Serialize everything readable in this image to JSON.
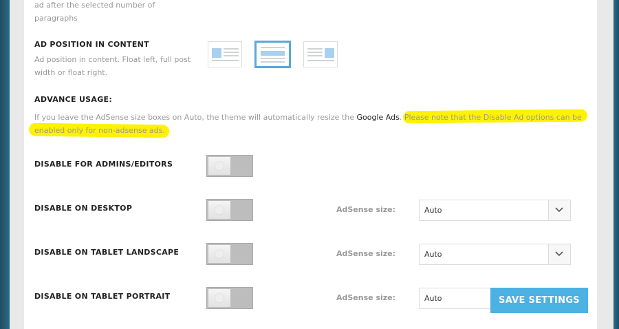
{
  "top_note": {
    "line1": "ad after the selected number of",
    "line2": "paragraphs"
  },
  "ad_position": {
    "title": "AD POSITION IN CONTENT",
    "desc_line1": "Ad position in content. Float left, full post",
    "desc_line2": "width or float right."
  },
  "advance": {
    "title": "ADVANCE USAGE:",
    "line1_before": "If you leave the AdSense size boxes on Auto, the theme will automatically resize the ",
    "line1_link": "Google Ads",
    "line1_after": ". Please note that the Disable Ad options can be",
    "line2": "enabled only for non-adsense ads."
  },
  "rows": [
    {
      "label": "DISABLE FOR ADMINS/EDITORS"
    },
    {
      "label": "DISABLE ON DESKTOP",
      "adsense_label": "AdSense size:",
      "select_value": "Auto"
    },
    {
      "label": "DISABLE ON TABLET LANDSCAPE",
      "adsense_label": "AdSense size:",
      "select_value": "Auto"
    },
    {
      "label": "DISABLE ON TABLET PORTRAIT",
      "adsense_label": "AdSense size:",
      "select_value": "Auto"
    }
  ],
  "save_button": "SAVE SETTINGS",
  "colors": {
    "accent": "#4cb1e3",
    "highlight": "#fff200",
    "selected_border": "#5aa8d6"
  }
}
